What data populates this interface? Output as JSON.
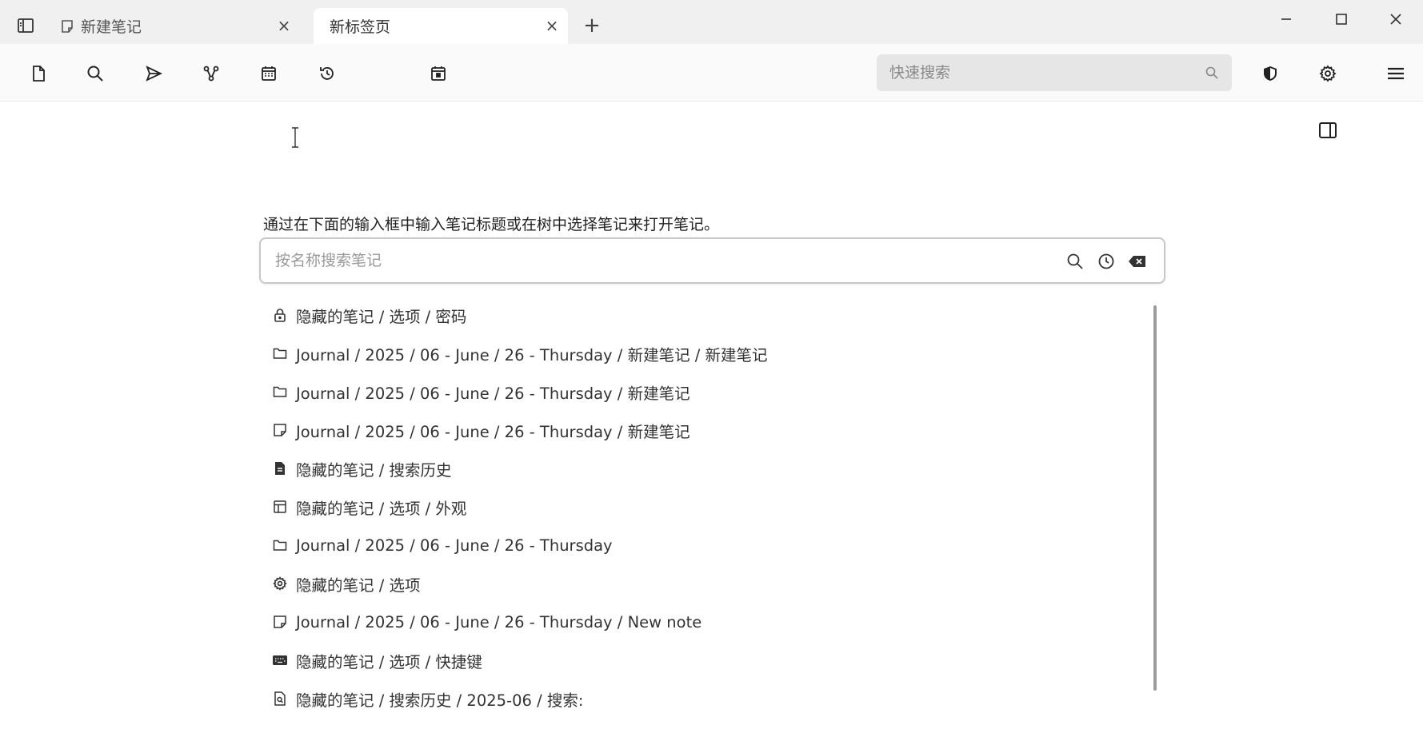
{
  "tabs": [
    {
      "title": "新建笔记",
      "close": "×"
    },
    {
      "title": "新标签页",
      "close": "×"
    }
  ],
  "new_tab_label": "+",
  "quick_search": {
    "placeholder": "快速搜索"
  },
  "instruction": "通过在下面的输入框中输入笔记标题或在树中选择笔记来打开笔记。",
  "note_search": {
    "placeholder": "按名称搜索笔记"
  },
  "results": [
    {
      "icon": "lock-icon",
      "path": "隐藏的笔记 / 选项 / 密码"
    },
    {
      "icon": "folder-icon",
      "path": "Journal / 2025 / 06 - June / 26 - Thursday / 新建笔记 / 新建笔记"
    },
    {
      "icon": "folder-icon",
      "path": "Journal / 2025 / 06 - June / 26 - Thursday / 新建笔记"
    },
    {
      "icon": "note-icon",
      "path": "Journal / 2025 / 06 - June / 26 - Thursday / 新建笔记"
    },
    {
      "icon": "document-icon",
      "path": "隐藏的笔记 / 搜索历史"
    },
    {
      "icon": "layout-icon",
      "path": "隐藏的笔记 / 选项 / 外观"
    },
    {
      "icon": "folder-icon",
      "path": "Journal / 2025 / 06 - June / 26 - Thursday"
    },
    {
      "icon": "gear-icon",
      "path": "隐藏的笔记 / 选项"
    },
    {
      "icon": "note-icon",
      "path": "Journal / 2025 / 06 - June / 26 - Thursday / New note"
    },
    {
      "icon": "keyboard-icon",
      "path": "隐藏的笔记 / 选项 / 快捷键"
    },
    {
      "icon": "search-doc-icon",
      "path": "隐藏的笔记 / 搜索历史 / 2025-06 / 搜索:"
    }
  ]
}
